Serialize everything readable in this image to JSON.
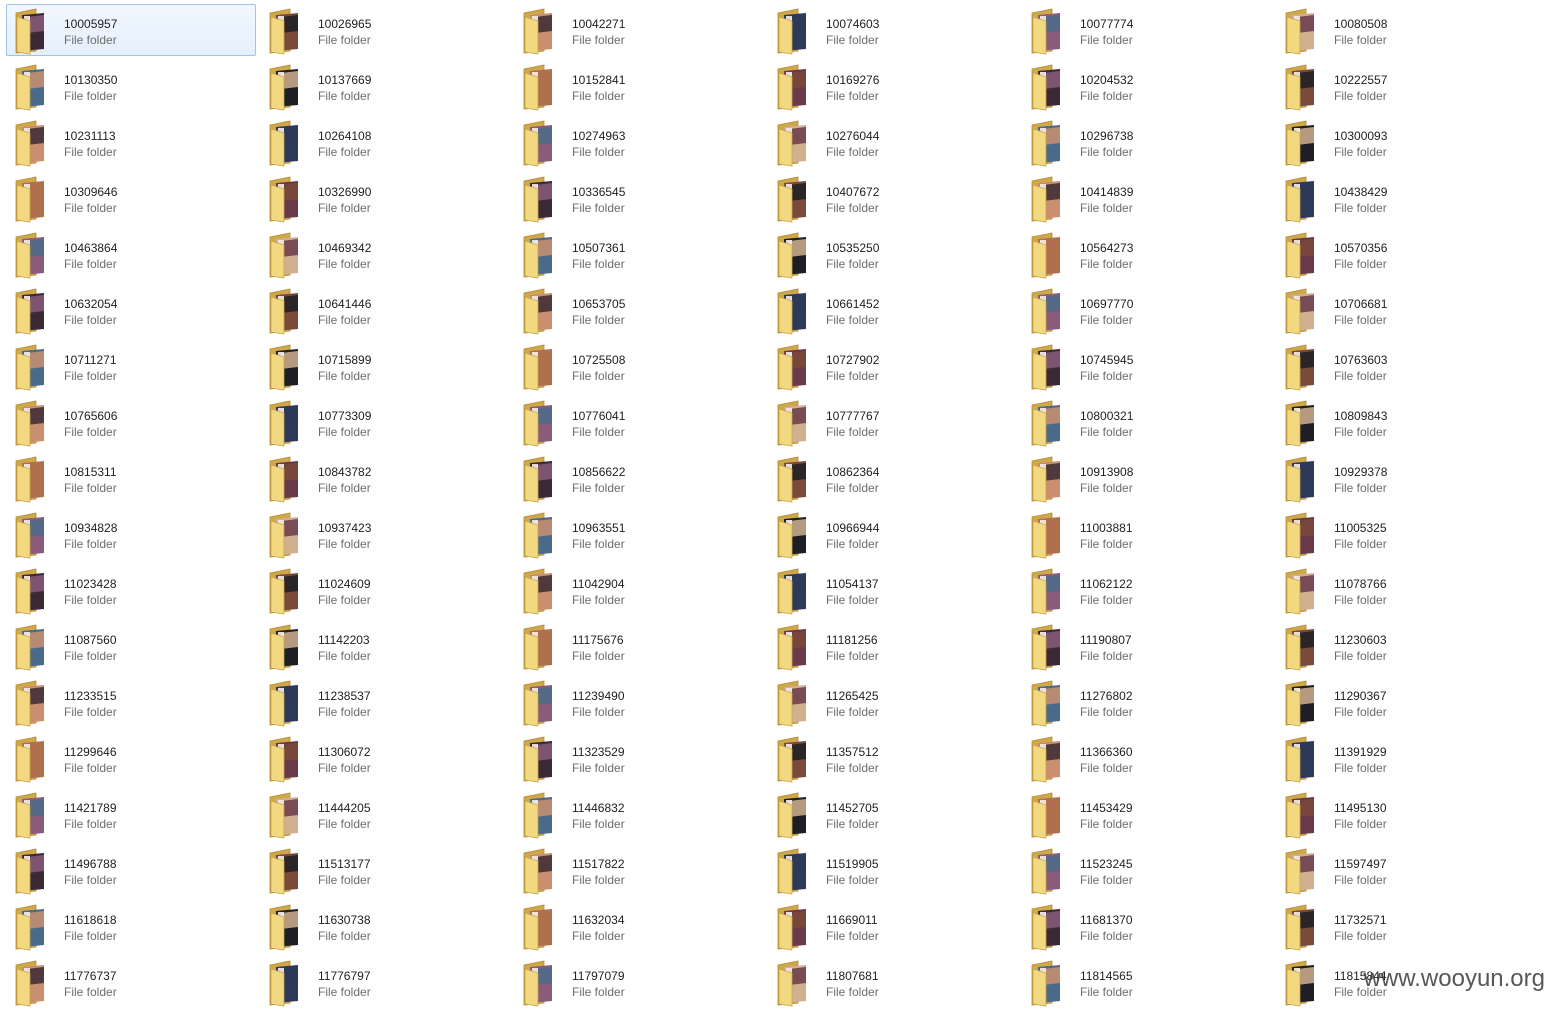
{
  "type_label": "File folder",
  "selected_index": 0,
  "folders": [
    "10005957",
    "10026965",
    "10042271",
    "10074603",
    "10077774",
    "10080508",
    "10130350",
    "10137669",
    "10152841",
    "10169276",
    "10204532",
    "10222557",
    "10231113",
    "10264108",
    "10274963",
    "10276044",
    "10296738",
    "10300093",
    "10309646",
    "10326990",
    "10336545",
    "10407672",
    "10414839",
    "10438429",
    "10463864",
    "10469342",
    "10507361",
    "10535250",
    "10564273",
    "10570356",
    "10632054",
    "10641446",
    "10653705",
    "10661452",
    "10697770",
    "10706681",
    "10711271",
    "10715899",
    "10725508",
    "10727902",
    "10745945",
    "10763603",
    "10765606",
    "10773309",
    "10776041",
    "10777767",
    "10800321",
    "10809843",
    "10815311",
    "10843782",
    "10856622",
    "10862364",
    "10913908",
    "10929378",
    "10934828",
    "10937423",
    "10963551",
    "10966944",
    "11003881",
    "11005325",
    "11023428",
    "11024609",
    "11042904",
    "11054137",
    "11062122",
    "11078766",
    "11087560",
    "11142203",
    "11175676",
    "11181256",
    "11190807",
    "11230603",
    "11233515",
    "11238537",
    "11239490",
    "11265425",
    "11276802",
    "11290367",
    "11299646",
    "11306072",
    "11323529",
    "11357512",
    "11366360",
    "11391929",
    "11421789",
    "11444205",
    "11446832",
    "11452705",
    "11453429",
    "11495130",
    "11496788",
    "11513177",
    "11517822",
    "11519905",
    "11523245",
    "11597497",
    "11618618",
    "11630738",
    "11632034",
    "11669011",
    "11681370",
    "11732571",
    "11776737",
    "11776797",
    "11797079",
    "11807681",
    "11814565",
    "11815844"
  ],
  "watermark": "www.wooyun.org",
  "colors": {
    "folder_back": "#d9b85a",
    "folder_front": "#f5dc8e",
    "selection_bg": "#e8f2fe",
    "selection_border": "#9ec4ea"
  }
}
